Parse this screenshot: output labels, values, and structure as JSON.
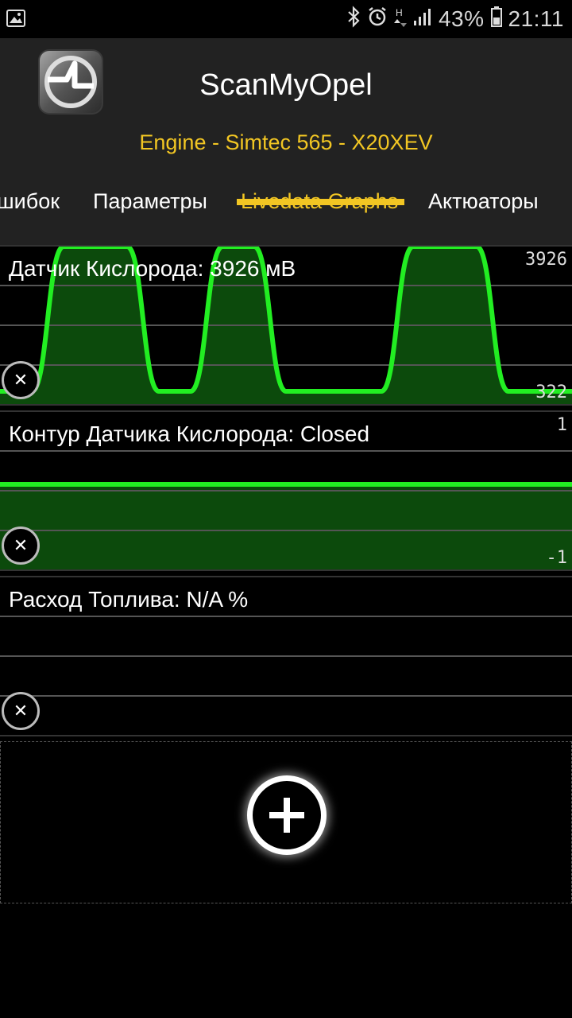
{
  "status_bar": {
    "battery": "43%",
    "time": "21:11",
    "icons": [
      "image-icon",
      "bluetooth-icon",
      "alarm-icon",
      "h-network-icon",
      "signal-icon",
      "battery-icon"
    ]
  },
  "header": {
    "title": "ScanMyOpel",
    "subtitle": "Engine - Simtec 565 - X20XEV",
    "logo_icon": "opel-logo"
  },
  "tabs": [
    {
      "label": "шибок",
      "active": false
    },
    {
      "label": "Параметры",
      "active": false
    },
    {
      "label": "Livedata Graphs",
      "active": true
    },
    {
      "label": "Актюаторы",
      "active": false
    }
  ],
  "graphs": [
    {
      "label": "Датчик Кислорода: 3926 мВ",
      "max": "3926",
      "min": "322",
      "line_color": "#22ee22",
      "fill_color": "#0c4a0c",
      "values": [
        322,
        322,
        3926,
        3926,
        3926,
        322,
        322,
        3926,
        3926,
        322,
        322,
        322,
        322,
        3926,
        3926,
        3926,
        322,
        322,
        322
      ]
    },
    {
      "label": "Контур Датчика Кислорода: Closed",
      "max": "1",
      "min": "-1",
      "line_color": "#22ee22",
      "fill_color": "#0c4a0c",
      "values": [
        0.0,
        0.0
      ]
    },
    {
      "label": "Расход Топлива: N/A %",
      "max": "",
      "min": "",
      "line_color": "#22ee22",
      "fill_color": "#0c4a0c",
      "values": []
    }
  ],
  "colors": {
    "accent": "#f2c623",
    "header_bg": "#222222",
    "graph_line": "#22ee22"
  }
}
